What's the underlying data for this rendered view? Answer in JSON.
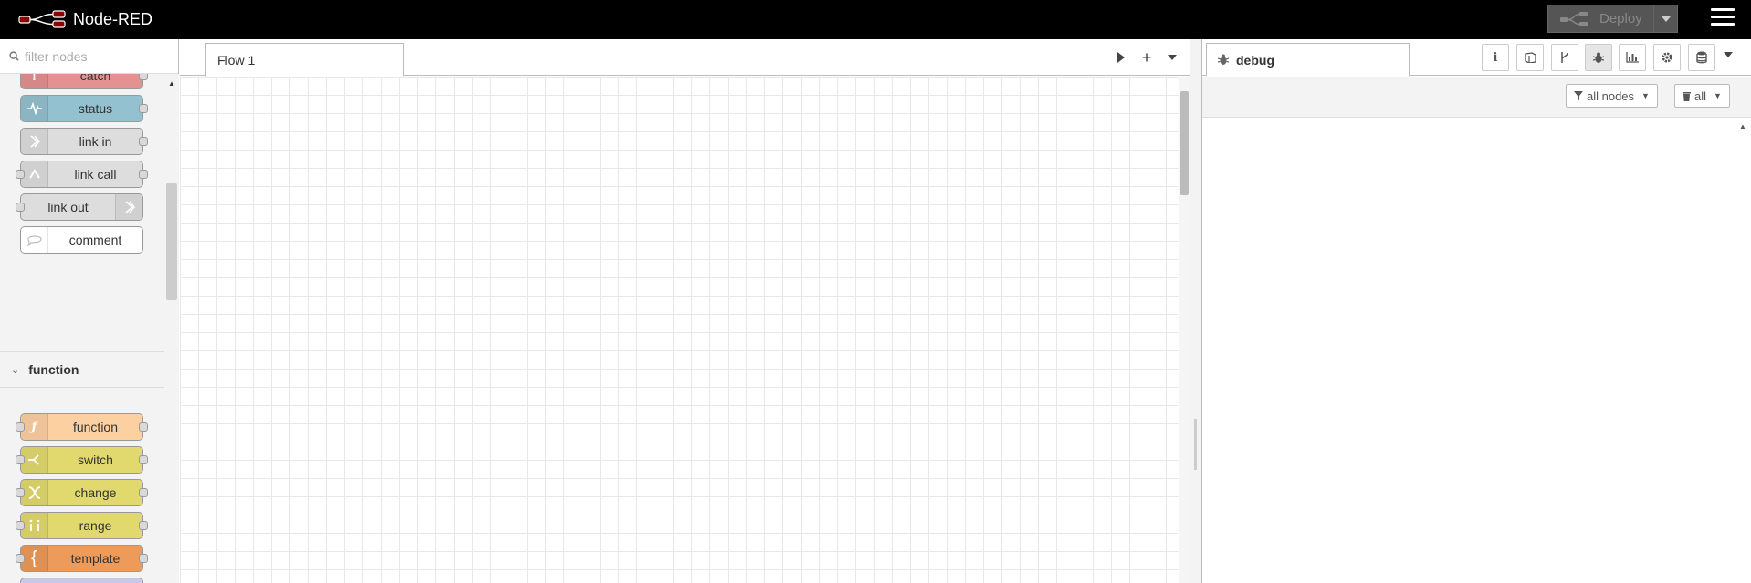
{
  "header": {
    "app_title": "Node-RED",
    "deploy_label": "Deploy"
  },
  "palette": {
    "search_placeholder": "filter nodes",
    "nodes_top": [
      {
        "label": "catch",
        "color": "#e49191",
        "icon": "!"
      },
      {
        "label": "status",
        "color": "#94c1d0",
        "icon": "~"
      },
      {
        "label": "link in",
        "color": "#dddddd",
        "icon": "»"
      },
      {
        "label": "link call",
        "color": "#dddddd",
        "icon": "↻"
      },
      {
        "label": "link out",
        "color": "#dddddd",
        "icon": "»"
      },
      {
        "label": "comment",
        "color": "#ffffff",
        "icon": "💬"
      }
    ],
    "category": "function",
    "nodes_function": [
      {
        "label": "function",
        "color": "#fdd0a2",
        "icon": "ƒ"
      },
      {
        "label": "switch",
        "color": "#e2d96e",
        "icon": "⑂"
      },
      {
        "label": "change",
        "color": "#e2d96e",
        "icon": "✕"
      },
      {
        "label": "range",
        "color": "#e2d96e",
        "icon": "i"
      },
      {
        "label": "template",
        "color": "#ec9b5b",
        "icon": "{"
      }
    ]
  },
  "workspace": {
    "tab_label": "Flow 1"
  },
  "sidebar": {
    "tab_label": "debug",
    "filter_nodes_label": "all nodes",
    "clear_label": "all"
  }
}
